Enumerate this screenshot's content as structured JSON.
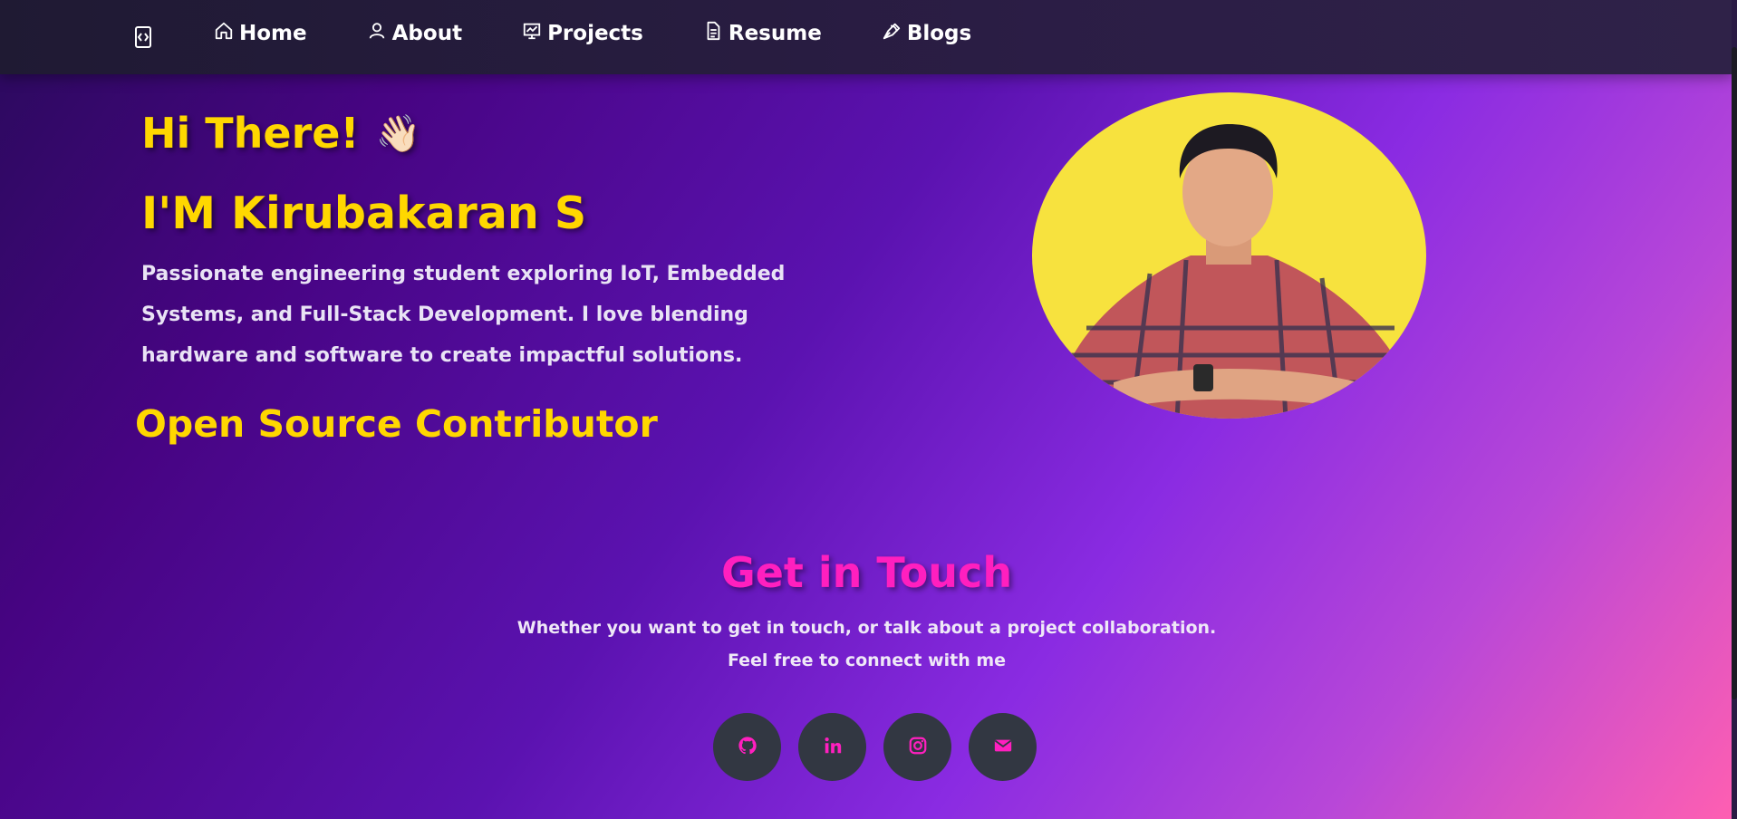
{
  "nav": {
    "items": [
      {
        "label": "Home",
        "icon": "home-icon"
      },
      {
        "label": "About",
        "icon": "user-icon"
      },
      {
        "label": "Projects",
        "icon": "presentation-chart-icon"
      },
      {
        "label": "Resume",
        "icon": "document-icon"
      },
      {
        "label": "Blogs",
        "icon": "pen-nib-icon"
      }
    ]
  },
  "hero": {
    "greeting": "Hi There!",
    "wave": "👋🏻",
    "name": "I'M Kirubakaran S",
    "description": "Passionate engineering student exploring IoT, Embedded Systems, and Full-Stack Development. I love blending hardware and software to create impactful solutions.",
    "role": "Open Source Contributor"
  },
  "contact": {
    "title": "Get in Touch",
    "line1": "Whether you want to get in touch, or talk about a project collaboration.",
    "line2": "Feel free to connect with me",
    "socials": [
      "github-icon",
      "linkedin-icon",
      "instagram-icon",
      "email-icon"
    ]
  },
  "colors": {
    "accent_yellow": "#ffd700",
    "accent_pink": "#ff1fbf",
    "avatar_bg": "#f7e23e",
    "social_bg": "#323742",
    "navbar_bg": "#231c38"
  }
}
